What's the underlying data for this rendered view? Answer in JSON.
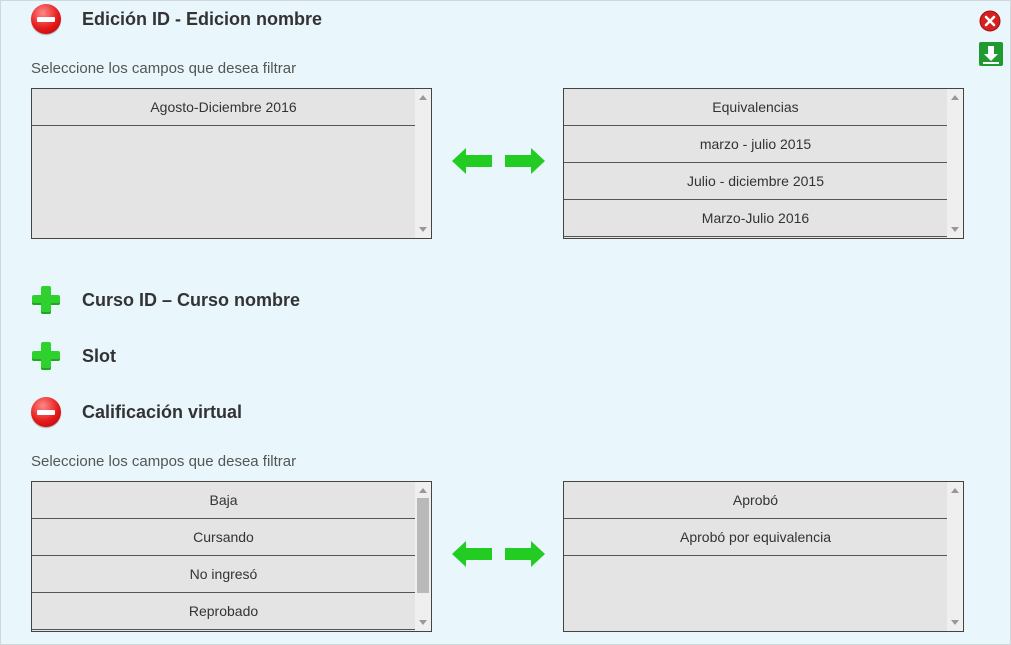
{
  "sections": [
    {
      "title": "Edición ID - Edicion nombre",
      "expanded": true,
      "hint": "Seleccione los campos que desea filtrar",
      "left_list": [
        "Agosto-Diciembre 2016"
      ],
      "right_list": [
        "Equivalencias",
        "marzo - julio 2015",
        "Julio - diciembre 2015",
        "Marzo-Julio 2016"
      ]
    },
    {
      "title": "Curso ID – Curso nombre",
      "expanded": false
    },
    {
      "title": "Slot",
      "expanded": false
    },
    {
      "title": "Calificación virtual",
      "expanded": true,
      "hint": "Seleccione los campos que desea filtrar",
      "left_list": [
        "Baja",
        "Cursando",
        "No ingresó",
        "Reprobado"
      ],
      "right_list": [
        "Aprobó",
        "Aprobó por equivalencia"
      ]
    }
  ],
  "icons": {
    "collapse": "minus-circle-icon",
    "expand": "plus-icon",
    "close": "close-icon",
    "download": "download-icon",
    "move_left": "arrow-left-icon",
    "move_right": "arrow-right-icon"
  },
  "colors": {
    "background": "#e9f6fb",
    "listbox": "#e4e4e4",
    "accent_green": "#22cc22",
    "danger_red": "#e51b1b"
  }
}
